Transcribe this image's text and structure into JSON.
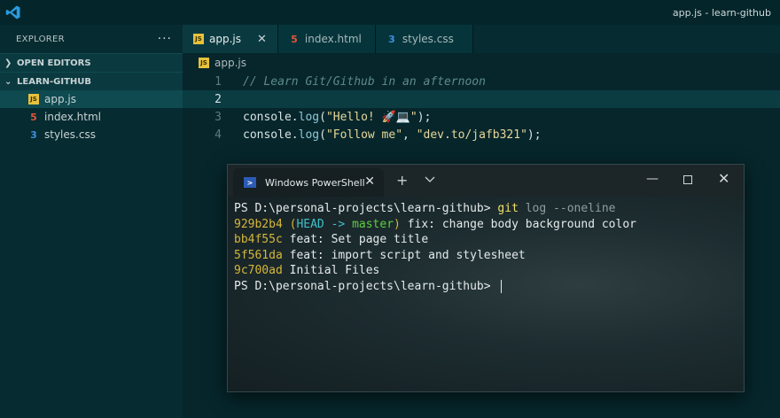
{
  "window": {
    "title": "app.js - learn-github"
  },
  "sidebar": {
    "header": "EXPLORER",
    "more": "···",
    "open_editors": "OPEN EDITORS",
    "folder": "LEARN-GITHUB",
    "files": [
      {
        "name": "app.js",
        "type": "js",
        "active": true
      },
      {
        "name": "index.html",
        "type": "html",
        "active": false
      },
      {
        "name": "styles.css",
        "type": "css",
        "active": false
      }
    ]
  },
  "tabs": [
    {
      "label": "app.js",
      "close": "✕"
    },
    {
      "label": "index.html"
    },
    {
      "label": "styles.css"
    }
  ],
  "breadcrumb": "app.js",
  "icons": {
    "js": "JS",
    "html": "5",
    "css": "3"
  },
  "code": {
    "line_numbers": [
      "1",
      "2",
      "3",
      "4"
    ],
    "line1_comment": "// Learn Git/Github in an afternoon",
    "line3_fn": "console",
    "line3_dot": ".",
    "line3_method": "log",
    "line3_open": "(",
    "line3_str": "\"Hello! 🚀💻\"",
    "line3_close": ");",
    "line4_fn": "console",
    "line4_dot": ".",
    "line4_method": "log",
    "line4_open": "(",
    "line4_str1": "\"Follow me\"",
    "line4_comma": ", ",
    "line4_str2": "\"dev.to/jafb321\"",
    "line4_close": ");"
  },
  "terminal": {
    "tab_title": "Windows PowerShell",
    "tab_close": "✕",
    "new_tab": "+",
    "minimize": "—",
    "close": "✕",
    "prompt": "PS D:\\personal-projects\\learn-github> ",
    "command": "git",
    "command_args": " log --oneline",
    "commits": [
      {
        "hash": "929b2b4",
        "message": " fix: change body background color"
      },
      {
        "hash": "bb4f55c",
        "message": " feat: Set page title"
      },
      {
        "hash": "5f561da",
        "message": " feat: import script and stylesheet"
      },
      {
        "hash": "9c700ad",
        "message": " Initial Files"
      }
    ],
    "head_open": " (",
    "head_label": "HEAD -> ",
    "branch": "master",
    "head_close": ")",
    "prompt_end": "PS D:\\personal-projects\\learn-github> "
  },
  "colors": {
    "background": "#062b30",
    "accent_hash": "#d6b73a",
    "accent_head": "#3ec1c9",
    "accent_branch": "#5fcf3f"
  }
}
